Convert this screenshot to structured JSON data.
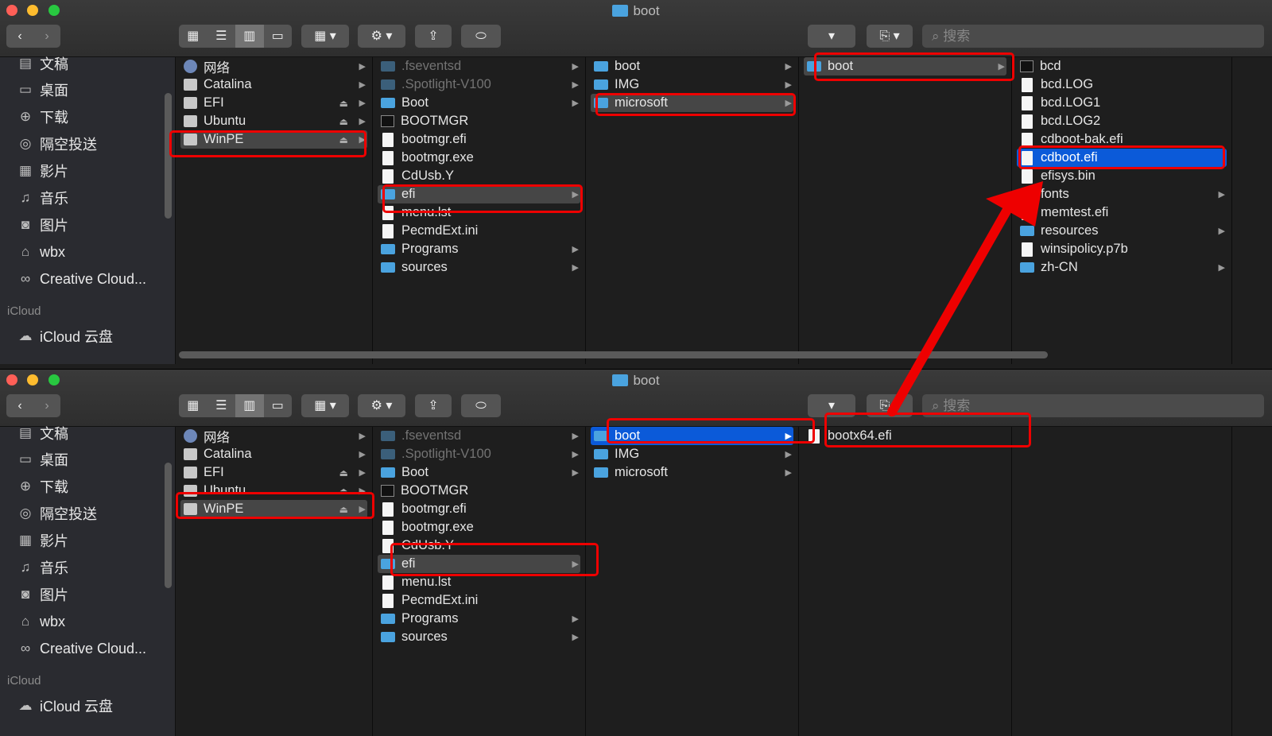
{
  "title": "boot",
  "search_placeholder": "搜索",
  "sidebar": {
    "items": [
      "文稿",
      "桌面",
      "下载",
      "隔空投送",
      "影片",
      "音乐",
      "图片",
      "wbx",
      "Creative Cloud..."
    ],
    "icloud_header": "iCloud",
    "icloud_item": "iCloud 云盘"
  },
  "window1": {
    "col1": [
      "网络",
      "Catalina",
      "EFI",
      "Ubuntu",
      "WinPE"
    ],
    "col2": [
      ".fseventsd",
      ".Spotlight-V100",
      "Boot",
      "BOOTMGR",
      "bootmgr.efi",
      "bootmgr.exe",
      "CdUsb.Y",
      "efi",
      "menu.lst",
      "PecmdExt.ini",
      "Programs",
      "sources"
    ],
    "col3": [
      "boot",
      "IMG",
      "microsoft"
    ],
    "col4": [
      "boot"
    ],
    "col5": [
      "bcd",
      "bcd.LOG",
      "bcd.LOG1",
      "bcd.LOG2",
      "cdboot-bak.efi",
      "cdboot.efi",
      "efisys.bin",
      "fonts",
      "memtest.efi",
      "resources",
      "winsipolicy.p7b",
      "zh-CN"
    ]
  },
  "window2": {
    "col1": [
      "网络",
      "Catalina",
      "EFI",
      "Ubuntu",
      "WinPE"
    ],
    "col2": [
      ".fseventsd",
      ".Spotlight-V100",
      "Boot",
      "BOOTMGR",
      "bootmgr.efi",
      "bootmgr.exe",
      "CdUsb.Y",
      "efi",
      "menu.lst",
      "PecmdExt.ini",
      "Programs",
      "sources"
    ],
    "col3": [
      "boot",
      "IMG",
      "microsoft"
    ],
    "col4": [
      "bootx64.efi"
    ]
  },
  "colors": {
    "highlight": "#ee0000",
    "selection": "#0b5ad9",
    "folder": "#4aa3df"
  }
}
